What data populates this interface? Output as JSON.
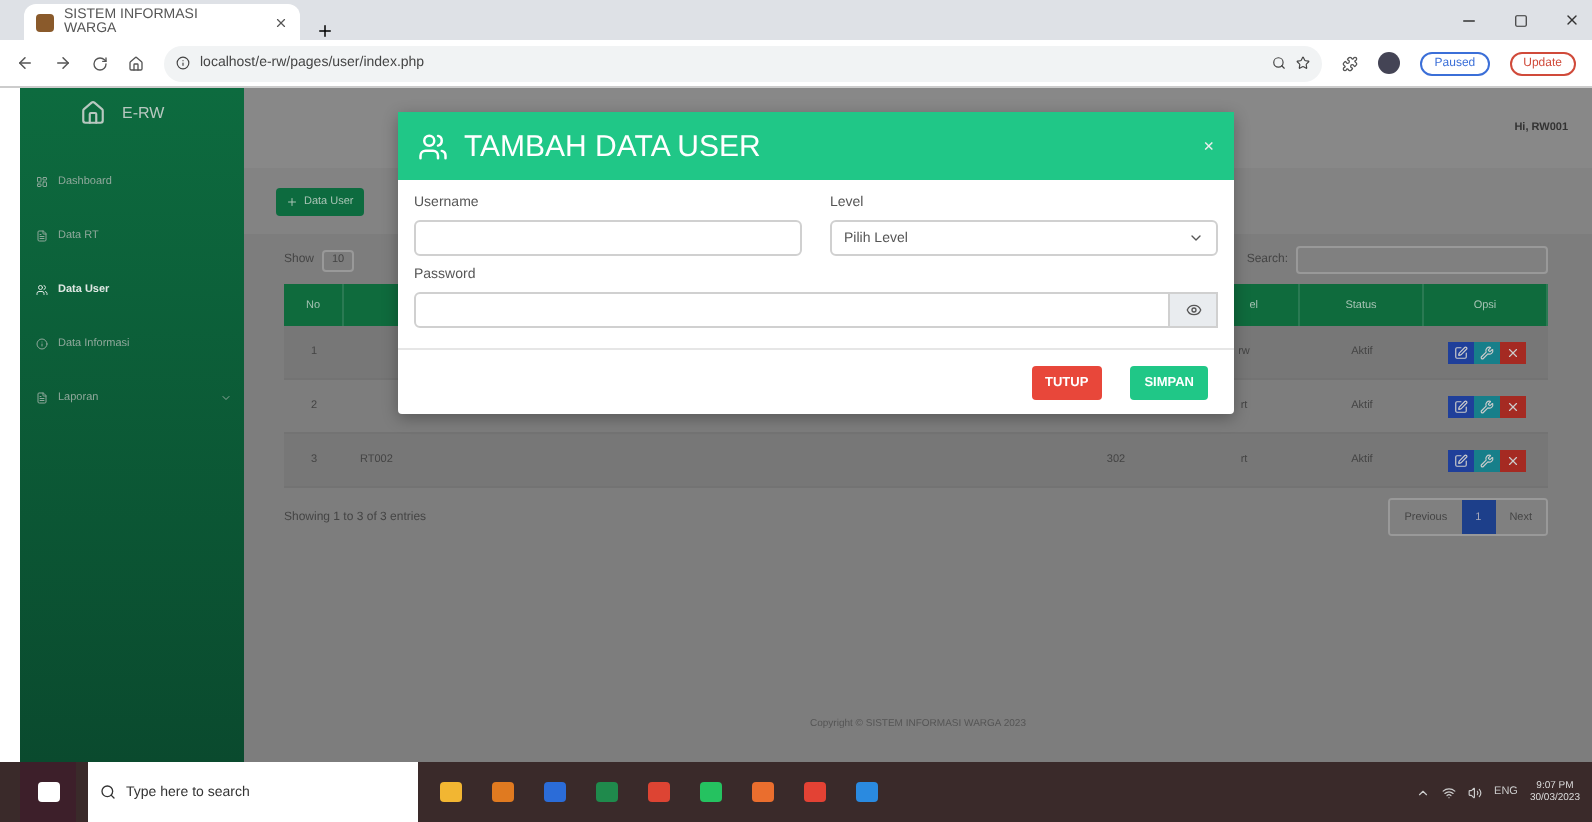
{
  "browser": {
    "tab_title": "SISTEM INFORMASI WARGA",
    "url": "localhost/e-rw/pages/user/index.php",
    "profile": "Paused",
    "update": "Update"
  },
  "sidebar": {
    "brand": "E-RW",
    "items": [
      {
        "label": "Dashboard",
        "selected": false,
        "expandable": false
      },
      {
        "label": "Data RT",
        "selected": false,
        "expandable": false
      },
      {
        "label": "Data User",
        "selected": true,
        "expandable": false
      },
      {
        "label": "Data Informasi",
        "selected": false,
        "expandable": false
      },
      {
        "label": "Laporan",
        "selected": false,
        "expandable": true
      }
    ]
  },
  "header": {
    "user": "Hi, RW001"
  },
  "add_button": "Data User",
  "show": {
    "label": "Show",
    "value": "10"
  },
  "search": {
    "label": "Search:"
  },
  "table": {
    "columns": {
      "no": "No",
      "level": "el",
      "status": "Status",
      "opsi": "Opsi"
    },
    "rows": [
      {
        "no": "1",
        "level": "rw",
        "status": "Aktif"
      },
      {
        "no": "2",
        "level": "rt",
        "status": "Aktif"
      },
      {
        "no": "3",
        "username": "RT002",
        "column_3": "302",
        "level": "rt",
        "status": "Aktif"
      }
    ]
  },
  "info": "Showing 1 to 3 of 3 entries",
  "pagination": [
    {
      "label": "Previous",
      "selected": false
    },
    {
      "label": "1",
      "selected": true
    },
    {
      "label": "Next",
      "selected": false
    }
  ],
  "footer": "Copyright © SISTEM INFORMASI WARGA 2023",
  "modal": {
    "title": "TAMBAH DATA USER",
    "close": "×",
    "username_label": "Username",
    "level_label": "Level",
    "level_placeholder": "Pilih Level",
    "password_label": "Password",
    "buttons": [
      {
        "label": "TUTUP",
        "kind": "cancel"
      },
      {
        "label": "SIMPAN",
        "kind": "save"
      }
    ]
  },
  "taskbar": {
    "search_placeholder": "Type here to search",
    "language": "ENG",
    "time": "9:07 PM",
    "date": "30/03/2023"
  }
}
